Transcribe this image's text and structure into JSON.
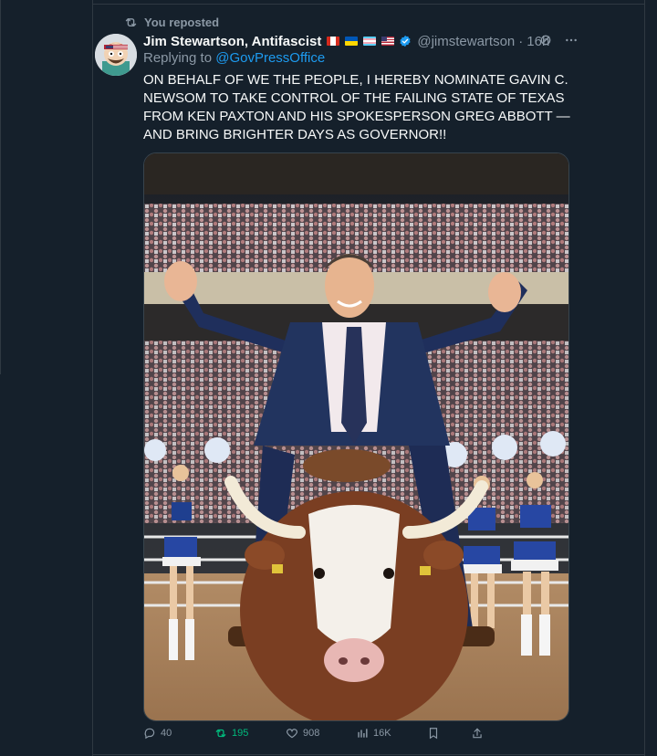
{
  "repost": {
    "text": "You reposted"
  },
  "author": {
    "name": "Jim Stewartson, Antifascist",
    "flags": [
      "canada-flag",
      "ukraine-flag",
      "trans-flag",
      "us-flag"
    ],
    "handle": "@jimstewartson",
    "dot": "·",
    "time": "16h",
    "verified": true
  },
  "reply": {
    "prefix": "Replying to",
    "target": "@GovPressOffice"
  },
  "post": {
    "text": "ON BEHALF OF WE THE PEOPLE, I HEREBY NOMINATE GAVIN C. NEWSOM TO TAKE CONTROL OF THE FAILING STATE OF TEXAS FROM KEN PAXTON AND HIS SPOKESPERSON GREG ABBOTT — AND BRING BRIGHTER DAYS AS GOVERNOR!!"
  },
  "actions": {
    "replies": "40",
    "reposts": "195",
    "likes": "908",
    "views": "16K"
  },
  "colors": {
    "background": "#15202b",
    "accent": "#1d9bf0",
    "repost_active": "#00ba7c",
    "muted": "#8b98a5"
  }
}
